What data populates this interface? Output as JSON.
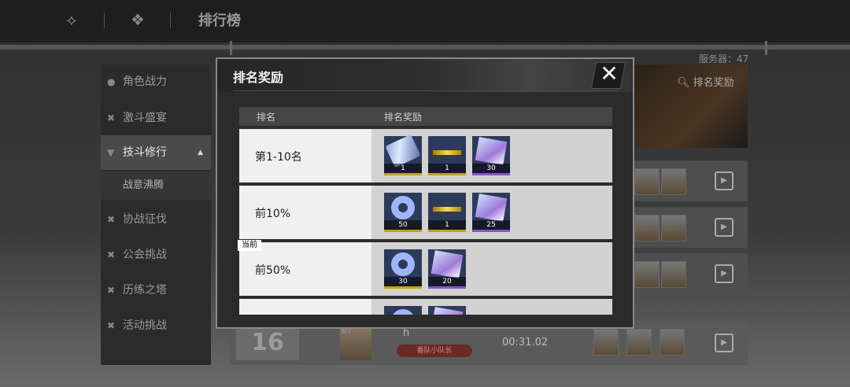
{
  "topbar": {
    "title": "排行榜"
  },
  "server_label": "服务器：47",
  "sidebar": {
    "items": [
      {
        "label": "角色战力"
      },
      {
        "label": "激斗盛宴"
      },
      {
        "label": "技斗修行"
      },
      {
        "label": "协战征伐"
      },
      {
        "label": "公会挑战"
      },
      {
        "label": "历练之塔"
      },
      {
        "label": "活动挑战"
      }
    ],
    "active_index": 2,
    "sub_item": "战意沸腾"
  },
  "right_panel": {
    "search_label": "排名奖励"
  },
  "my_rank": {
    "rank": "16",
    "level": "67",
    "name": "h",
    "badge": "番队小队长",
    "time": "00:31.02"
  },
  "modal": {
    "title": "排名奖励",
    "columns": {
      "rank": "排名",
      "reward": "排名奖励"
    },
    "current_tag": "当前",
    "rows": [
      {
        "label": "第1-10名",
        "items": [
          {
            "icon": "ticket-icon",
            "count": "1",
            "rarity": "gold"
          },
          {
            "icon": "gold-bar-icon",
            "count": "1",
            "rarity": "gold"
          },
          {
            "icon": "map-crystal-icon",
            "count": "30",
            "rarity": "purple"
          }
        ]
      },
      {
        "label": "前10%",
        "items": [
          {
            "icon": "ring-icon",
            "count": "50",
            "rarity": "gold"
          },
          {
            "icon": "gold-bar-icon",
            "count": "1",
            "rarity": "gold"
          },
          {
            "icon": "map-crystal-icon",
            "count": "25",
            "rarity": "purple"
          }
        ]
      },
      {
        "label": "前50%",
        "items": [
          {
            "icon": "ring-icon",
            "count": "30",
            "rarity": "gold"
          },
          {
            "icon": "map-crystal-icon",
            "count": "20",
            "rarity": "purple"
          }
        ]
      },
      {
        "label": "",
        "items": [
          {
            "icon": "ring-icon",
            "count": "",
            "rarity": "gold"
          },
          {
            "icon": "map-crystal-icon",
            "count": "",
            "rarity": "purple"
          }
        ]
      }
    ]
  },
  "colors": {
    "gold_rarity": "#c9a200",
    "purple_rarity": "#8a4fd6"
  }
}
